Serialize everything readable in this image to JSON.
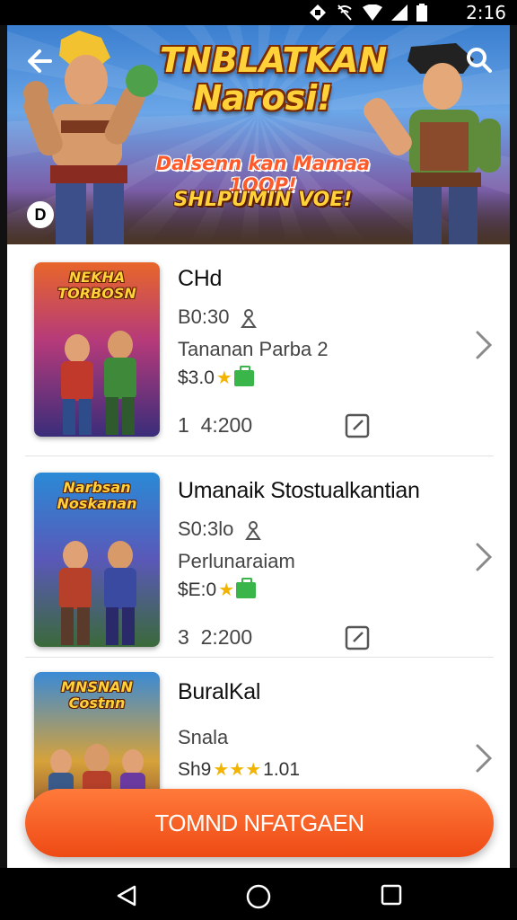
{
  "status_bar": {
    "time": "2:16"
  },
  "hero": {
    "title_line1": "TNBLATKAN",
    "title_line2": "Narosi!",
    "tagline": "Dalsenn kan Mamaa 1OOP!",
    "subtagline": "SHLPUMIN VOE!",
    "badge": "D",
    "icons": [
      "back-arrow-icon",
      "search-icon"
    ]
  },
  "games": [
    {
      "cover_title": "NEKHA TORBOSN",
      "title": "CHd",
      "meta": "B0:30",
      "genre": "Tananan Parba 2",
      "price": "$3.0",
      "stat_prefix": "1",
      "stat_value": "4:200"
    },
    {
      "cover_title": "Narbsan Noskanan",
      "title": "Umanaik Stostualkantian",
      "meta": "S0:3lo",
      "genre": "Perlunaraiam",
      "price": "$E:0",
      "stat_prefix": "3",
      "stat_value": "2:200"
    },
    {
      "cover_title": "MNSNAN Costnn",
      "title": "BuralKal",
      "meta": "Snala",
      "price_prefix": "Sh9",
      "price_suffix": "1.01"
    }
  ],
  "cta": {
    "label": "TOMND NFATGAEN"
  },
  "colors": {
    "cta": "#ee4a14",
    "star": "#f2b400",
    "tag": "#39b54a"
  }
}
